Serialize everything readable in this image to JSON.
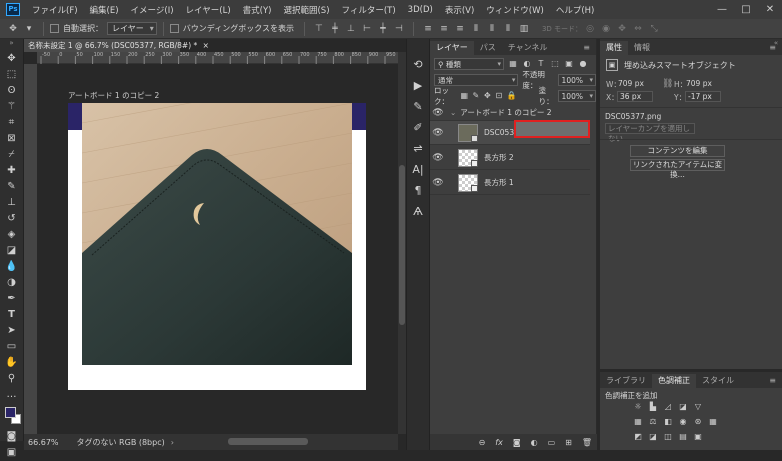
{
  "app": {
    "logo": "Ps"
  },
  "menubar": {
    "items": [
      "ファイル(F)",
      "編集(E)",
      "イメージ(I)",
      "レイヤー(L)",
      "書式(Y)",
      "選択範囲(S)",
      "フィルター(T)",
      "3D(D)",
      "表示(V)",
      "ウィンドウ(W)",
      "ヘルプ(H)"
    ],
    "window_controls": [
      "—",
      "□",
      "✕"
    ]
  },
  "options_bar": {
    "auto_select_label": "自動選択：",
    "auto_select_target": "レイヤー",
    "bounding_box_label": "バウンディングボックスを表示",
    "mode_3d_label": "3D モード："
  },
  "document": {
    "tab_title": "名称未設定 1 @ 66.7% (DSC05377, RGB/8#) *",
    "close": "×",
    "artboard_name": "アートボード 1 のコピー 2",
    "zoom": "66.67%",
    "color_profile": "タグのない RGB (8bpc)",
    "ruler_marks": [
      "-50",
      "0",
      "50",
      "100",
      "150",
      "200",
      "250",
      "300",
      "350",
      "400",
      "450",
      "500",
      "550",
      "600",
      "650",
      "700",
      "750",
      "800",
      "850",
      "900",
      "950"
    ]
  },
  "layers_panel": {
    "tabs": [
      "レイヤー",
      "パス",
      "チャンネル"
    ],
    "filter_kind": "種類",
    "blend_mode": "通常",
    "opacity_label": "不透明度：",
    "opacity_value": "100%",
    "lock_label": "ロック：",
    "fill_label": "塗り：",
    "fill_value": "100%",
    "artboard_group": "アートボード 1 のコピー 2",
    "layers": [
      {
        "name": "DSC05377",
        "type": "smart-object"
      },
      {
        "name": "長方形 2",
        "type": "shape"
      },
      {
        "name": "長方形 1",
        "type": "shape"
      }
    ],
    "footer_icons": [
      "link-icon",
      "fx-icon",
      "mask-icon",
      "adjustment-icon",
      "folder-icon",
      "new-layer-icon",
      "trash-icon"
    ]
  },
  "properties_panel": {
    "tabs": [
      "属性",
      "情報"
    ],
    "title": "埋め込みスマートオブジェクト",
    "w_label": "W：",
    "w_value": "709 px",
    "h_label": "H：",
    "h_value": "709 px",
    "x_label": "X：",
    "x_value": "36 px",
    "y_label": "Y：",
    "y_value": "-17 px",
    "filename": "DSC05377.png",
    "layer_comp_placeholder": "レイヤーカンプを適用しない",
    "edit_contents_button": "コンテンツを編集",
    "convert_linked_button": "リンクされたアイテムに変換..."
  },
  "adjustments_panel": {
    "tabs": [
      "ライブラリ",
      "色調補正",
      "スタイル"
    ],
    "add_label": "色調補正を追加"
  },
  "colors": {
    "accent": "#31a8ff",
    "artboard_band": "#2a2467",
    "foreground": "#2a2467",
    "highlight": "#e02020"
  }
}
